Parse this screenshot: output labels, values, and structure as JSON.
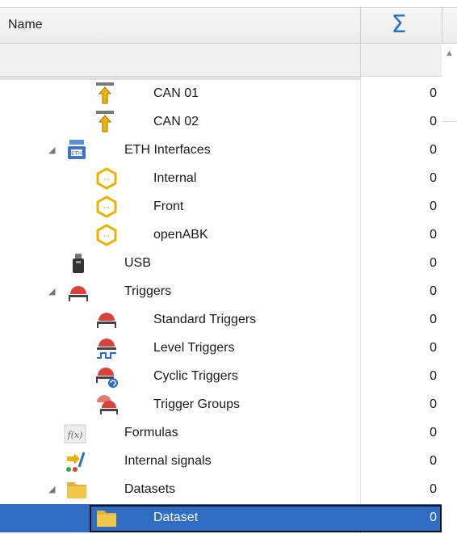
{
  "header": {
    "name_label": "Name",
    "sum_label": "Σ"
  },
  "rows": [
    {
      "label": "CAN 01",
      "value": "0",
      "icon": "can-icon"
    },
    {
      "label": "CAN 02",
      "value": "0",
      "icon": "can-icon"
    },
    {
      "label": "ETH Interfaces",
      "value": "0",
      "icon": "ethernet-icon",
      "expanded": true
    },
    {
      "label": "Internal",
      "value": "0",
      "icon": "interface-icon"
    },
    {
      "label": "Front",
      "value": "0",
      "icon": "interface-icon"
    },
    {
      "label": "openABK",
      "value": "0",
      "icon": "interface-icon"
    },
    {
      "label": "USB",
      "value": "0",
      "icon": "usb-icon"
    },
    {
      "label": "Triggers",
      "value": "0",
      "icon": "trigger-icon",
      "expanded": true
    },
    {
      "label": "Standard Triggers",
      "value": "0",
      "icon": "standard-trigger-icon"
    },
    {
      "label": "Level Triggers",
      "value": "0",
      "icon": "level-trigger-icon"
    },
    {
      "label": "Cyclic Triggers",
      "value": "0",
      "icon": "cyclic-trigger-icon"
    },
    {
      "label": "Trigger Groups",
      "value": "0",
      "icon": "trigger-group-icon"
    },
    {
      "label": "Formulas",
      "value": "0",
      "icon": "formula-icon"
    },
    {
      "label": "Internal signals",
      "value": "0",
      "icon": "internal-signals-icon"
    },
    {
      "label": "Datasets",
      "value": "0",
      "icon": "folder-icon",
      "expanded": true
    },
    {
      "label": "Dataset",
      "value": "0",
      "icon": "folder-icon",
      "selected": true
    }
  ]
}
